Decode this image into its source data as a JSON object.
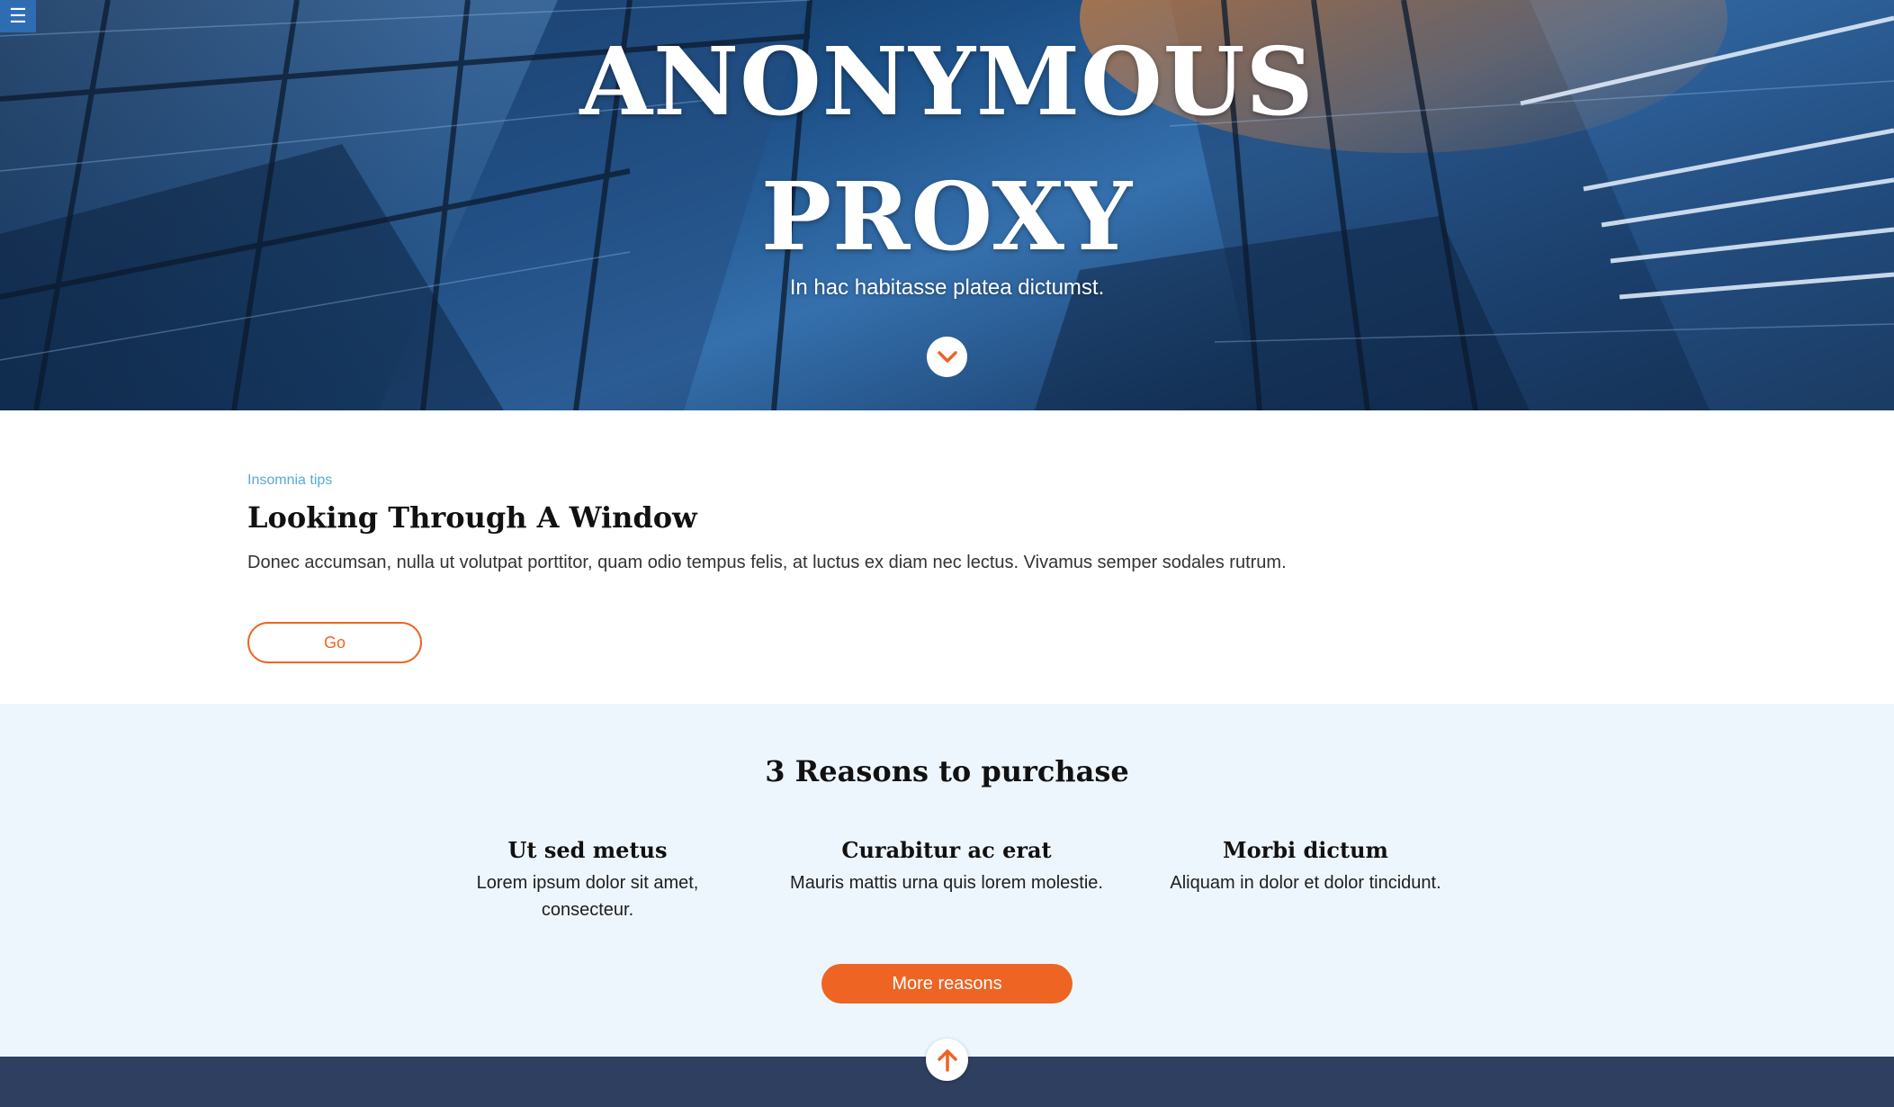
{
  "menu": {
    "icon": "hamburger-menu-icon",
    "glyph": "☰"
  },
  "hero": {
    "title_line1": "ANONYMOUS",
    "title_line2": "PROXY",
    "subtitle": "In hac habitasse platea dictumst.",
    "scroll_icon": "chevron-down-icon"
  },
  "article": {
    "eyebrow": "Insomnia tips",
    "heading": "Looking Through A Window",
    "body": "Donec accumsan, nulla ut volutpat porttitor, quam odio tempus felis, at luctus ex diam nec lectus. Vivamus semper sodales rutrum.",
    "button_label": "Go"
  },
  "reasons": {
    "title": "3 Reasons to purchase",
    "items": [
      {
        "title": "Ut sed metus",
        "text": "Lorem ipsum dolor sit amet, consecteur."
      },
      {
        "title": "Curabitur ac erat",
        "text": "Mauris mattis urna quis lorem molestie."
      },
      {
        "title": "Morbi dictum",
        "text": "Aliquam in dolor et dolor tincidunt."
      }
    ],
    "button_label": "More reasons"
  },
  "footer": {
    "scroll_top_icon": "arrow-up-icon"
  },
  "colors": {
    "accent": "#ee6423",
    "menu_blue": "#2f6db3",
    "eyebrow_blue": "#5aa9d8",
    "section_bg": "#eef6fd",
    "footer_bg": "#2e3f60"
  }
}
